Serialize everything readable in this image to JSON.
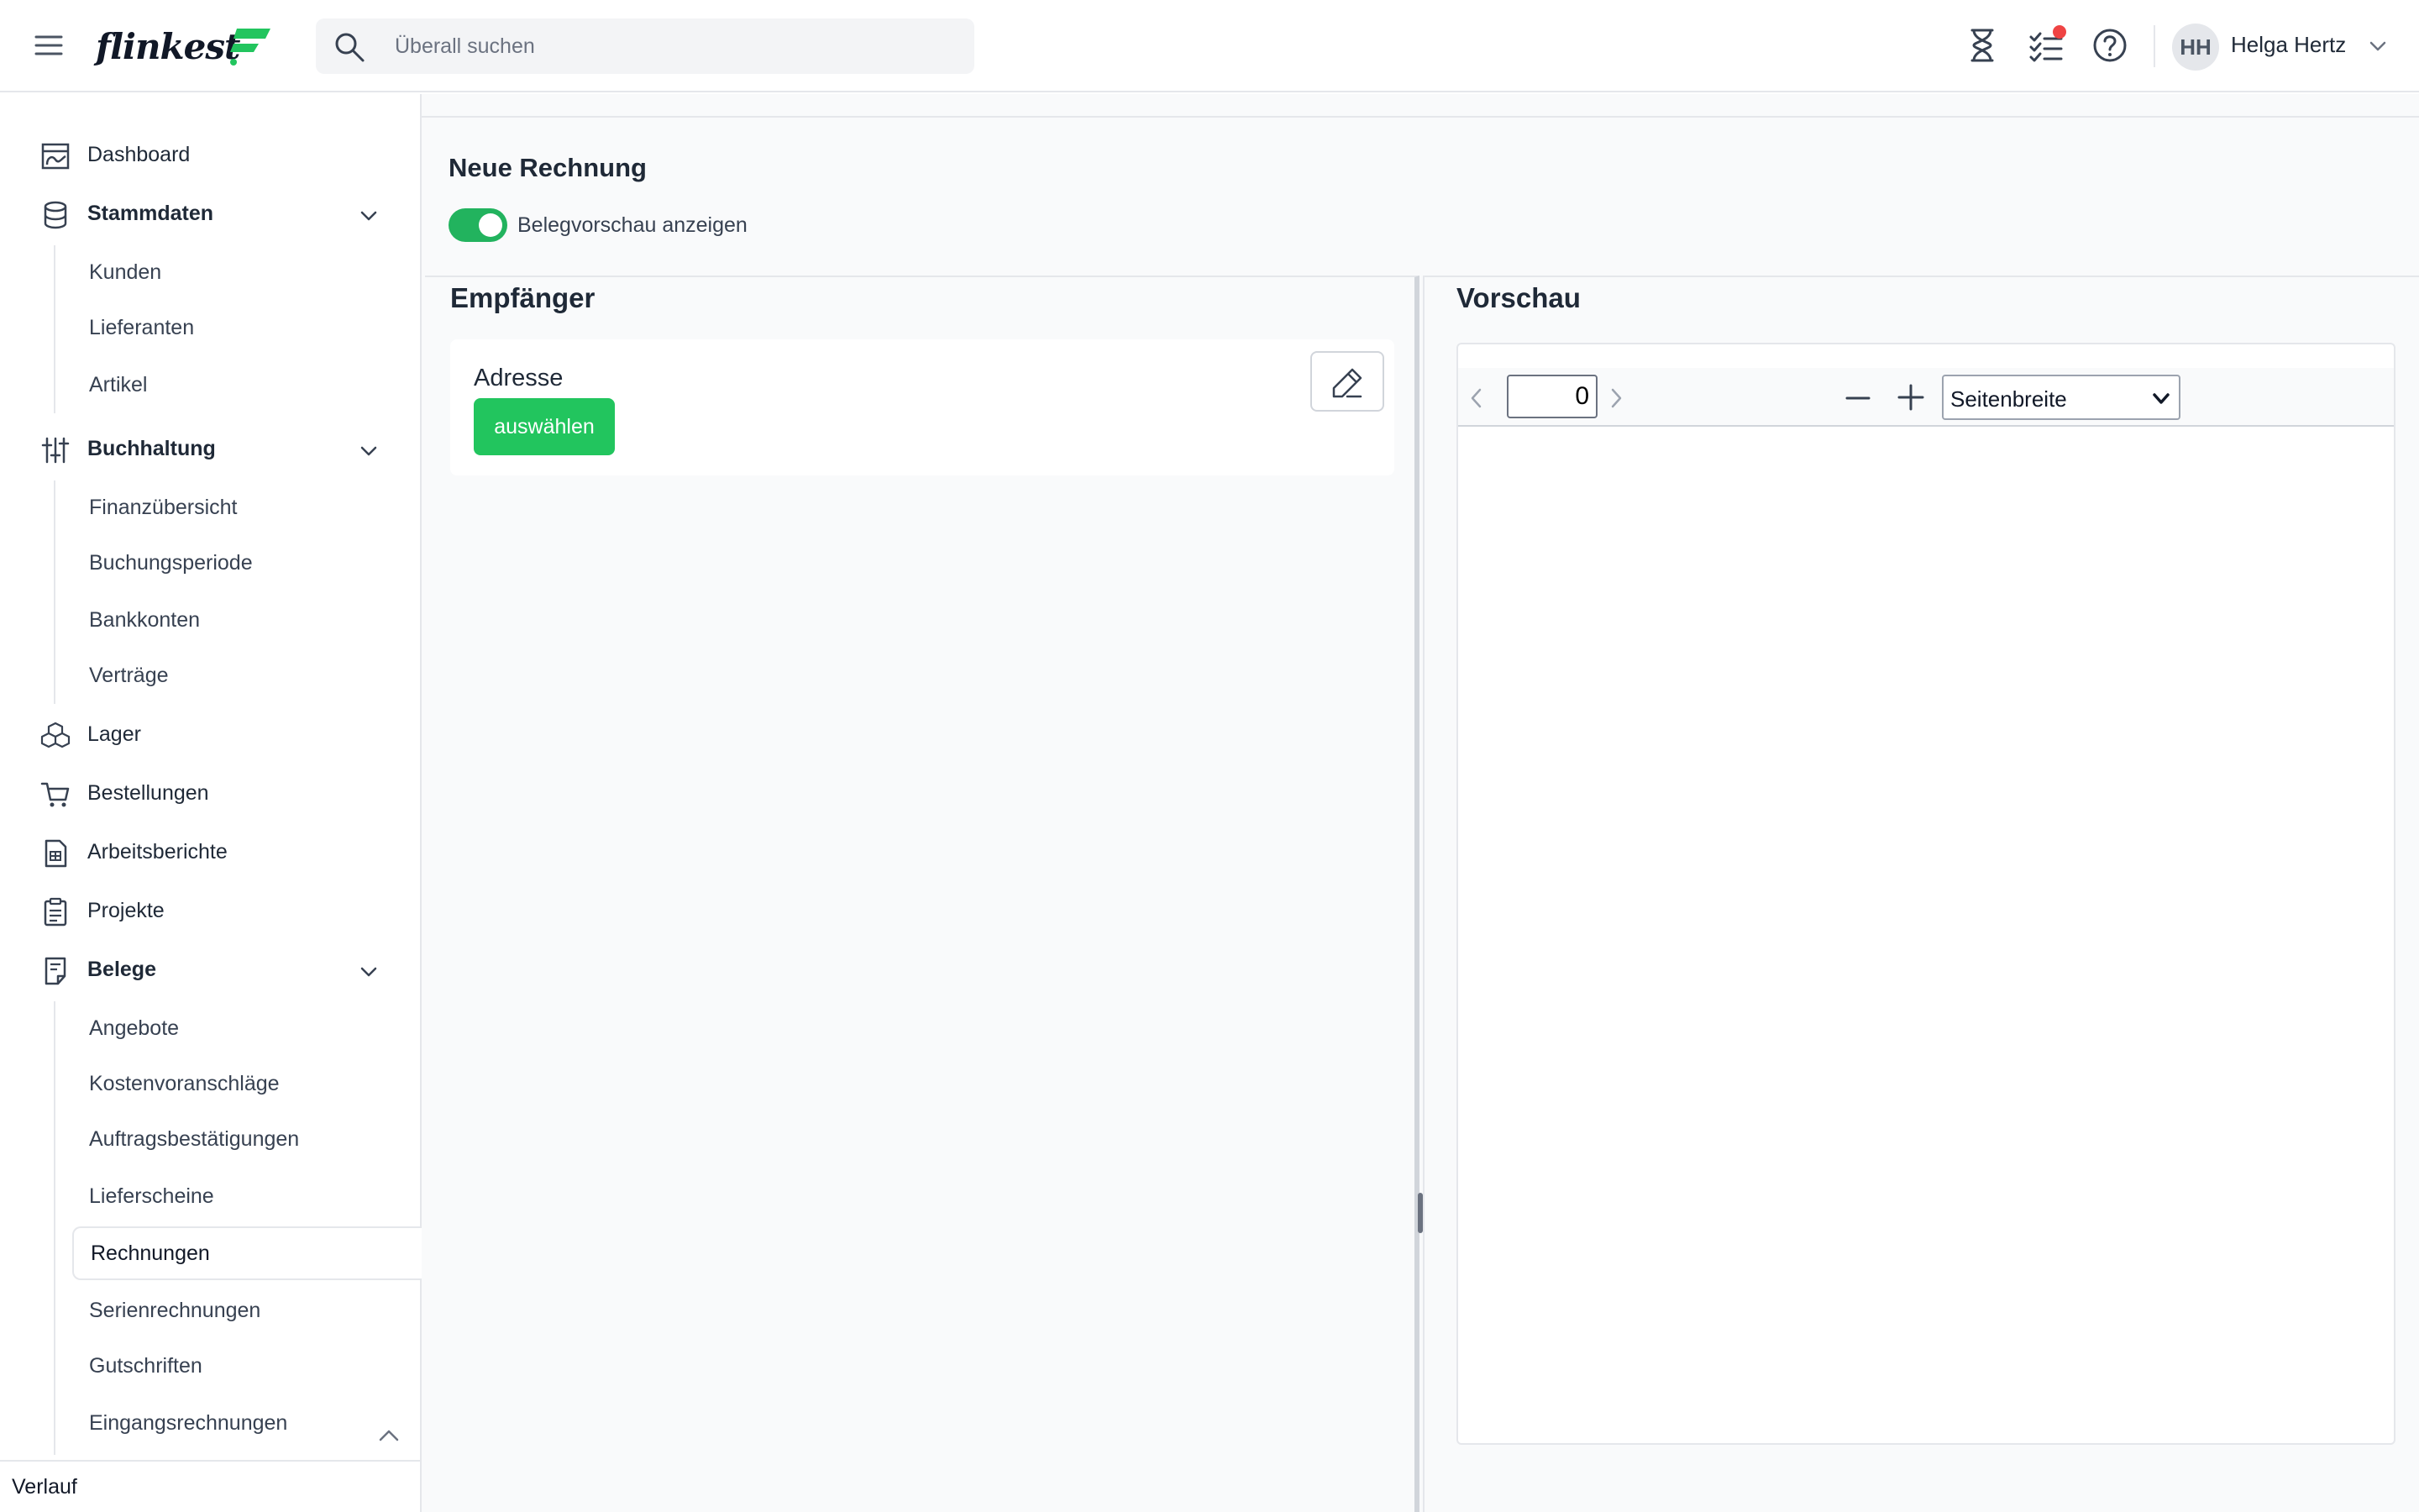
{
  "app": {
    "logo_text": "flinkest"
  },
  "search": {
    "placeholder": "Überall suchen"
  },
  "user": {
    "initials": "HH",
    "name": "Helga Hertz"
  },
  "sidebar": {
    "items": [
      {
        "label": "Dashboard",
        "icon": "dashboard-icon"
      },
      {
        "label": "Stammdaten",
        "icon": "database-icon",
        "expanded": true,
        "children": [
          "Kunden",
          "Lieferanten",
          "Artikel"
        ]
      },
      {
        "label": "Buchhaltung",
        "icon": "sliders-icon",
        "expanded": true,
        "children": [
          "Finanzübersicht",
          "Buchungsperiode",
          "Bankkonten",
          "Verträge"
        ]
      },
      {
        "label": "Lager",
        "icon": "boxes-icon"
      },
      {
        "label": "Bestellungen",
        "icon": "cart-icon"
      },
      {
        "label": "Arbeitsberichte",
        "icon": "report-icon"
      },
      {
        "label": "Projekte",
        "icon": "clipboard-icon"
      },
      {
        "label": "Belege",
        "icon": "document-icon",
        "expanded": true,
        "children": [
          "Angebote",
          "Kostenvoranschläge",
          "Auftragsbestätigungen",
          "Lieferscheine",
          "Rechnungen",
          "Serienrechnungen",
          "Gutschriften",
          "Eingangsrechnungen"
        ]
      }
    ],
    "active_item": "Rechnungen",
    "footer_label": "Verlauf"
  },
  "page": {
    "title": "Neue Rechnung",
    "toggle_label": "Belegvorschau anzeigen",
    "toggle_on": true
  },
  "recipient": {
    "title": "Empfänger",
    "address_label": "Adresse",
    "select_button": "auswählen"
  },
  "preview": {
    "title": "Vorschau",
    "page_number": "0",
    "zoom_option": "Seitenbreite"
  },
  "colors": {
    "accent": "#22c55e",
    "toggle": "#22b35e",
    "notification": "#ef4444"
  }
}
